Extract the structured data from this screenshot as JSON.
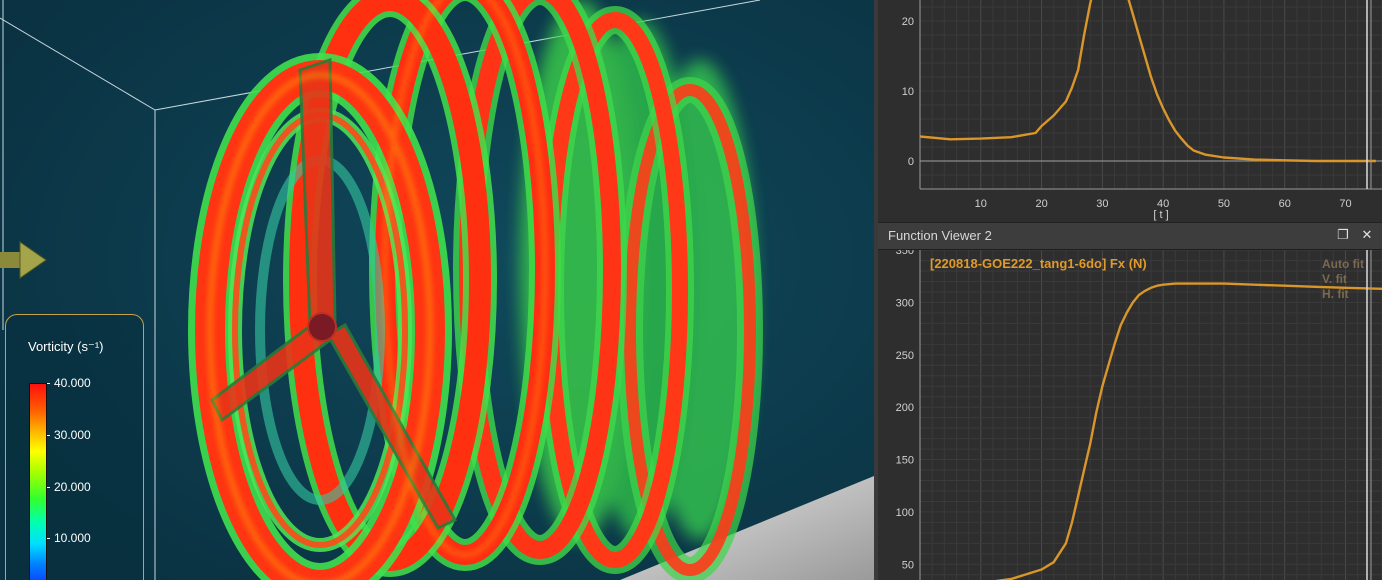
{
  "viewport": {
    "legend": {
      "title": "Vorticity (s⁻¹)",
      "ticks": [
        "40.000",
        "30.000",
        "20.000",
        "10.000"
      ]
    },
    "background_color": "#0d3a4a",
    "scene_object": "rotor-vorticity-volume"
  },
  "viewer1": {
    "title": "",
    "x_axis_label": "[ t ]",
    "y_ticks": [
      "0",
      "10",
      "20"
    ],
    "x_ticks": [
      "10",
      "20",
      "30",
      "40",
      "50",
      "60",
      "70"
    ]
  },
  "viewer2": {
    "title": "Function Viewer 2",
    "series_label": "[220818-GOE222_tang1-6do] Fx (N)",
    "overlay_buttons": [
      "Auto fit",
      "V. fit",
      "H. fit"
    ],
    "y_ticks": [
      "350",
      "300",
      "250",
      "200",
      "150",
      "100",
      "50"
    ],
    "restore_icon": "restore-icon",
    "close_icon": "close-icon"
  },
  "chart_data": [
    {
      "type": "line",
      "title": "",
      "xlabel": "[ t ]",
      "ylabel": "",
      "xlim": [
        0,
        76
      ],
      "ylim": [
        -4,
        23
      ],
      "grid": true,
      "series": [
        {
          "color": "#d9962a",
          "x": [
            0,
            5,
            10,
            15,
            19,
            20,
            22,
            24,
            25,
            26,
            27,
            28,
            29,
            30,
            31,
            32,
            33,
            34,
            35,
            36,
            37,
            38,
            39,
            40,
            41,
            42,
            43,
            44,
            45,
            47,
            50,
            55,
            60,
            65,
            70,
            75
          ],
          "y": [
            3.5,
            3.1,
            3.2,
            3.4,
            4.0,
            5.0,
            6.5,
            8.5,
            10.5,
            13.0,
            18.0,
            22.5,
            26.0,
            28.5,
            29.5,
            29.0,
            27.0,
            24.0,
            21.0,
            18.0,
            15.0,
            12.0,
            9.5,
            7.5,
            5.8,
            4.3,
            3.2,
            2.2,
            1.5,
            0.9,
            0.5,
            0.2,
            0.1,
            0.0,
            0.0,
            0.0
          ]
        }
      ]
    },
    {
      "type": "line",
      "title": "",
      "xlabel": "",
      "ylabel": "",
      "xlim": [
        0,
        76
      ],
      "ylim": [
        35,
        352
      ],
      "grid": true,
      "series": [
        {
          "name": "[220818-GOE222_tang1-6do] Fx (N)",
          "color": "#d9962a",
          "x": [
            0,
            5,
            10,
            15,
            20,
            22,
            24,
            25,
            26,
            27,
            28,
            29,
            30,
            31,
            32,
            33,
            34,
            35,
            36,
            37,
            38,
            39,
            40,
            42,
            45,
            50,
            55,
            60,
            65,
            70,
            76
          ],
          "y": [
            30,
            30,
            32,
            36,
            45,
            52,
            70,
            90,
            115,
            140,
            165,
            195,
            220,
            240,
            260,
            278,
            290,
            300,
            307,
            311,
            314,
            316,
            317,
            318,
            318,
            318,
            317,
            316,
            315,
            314,
            313
          ]
        }
      ]
    }
  ]
}
